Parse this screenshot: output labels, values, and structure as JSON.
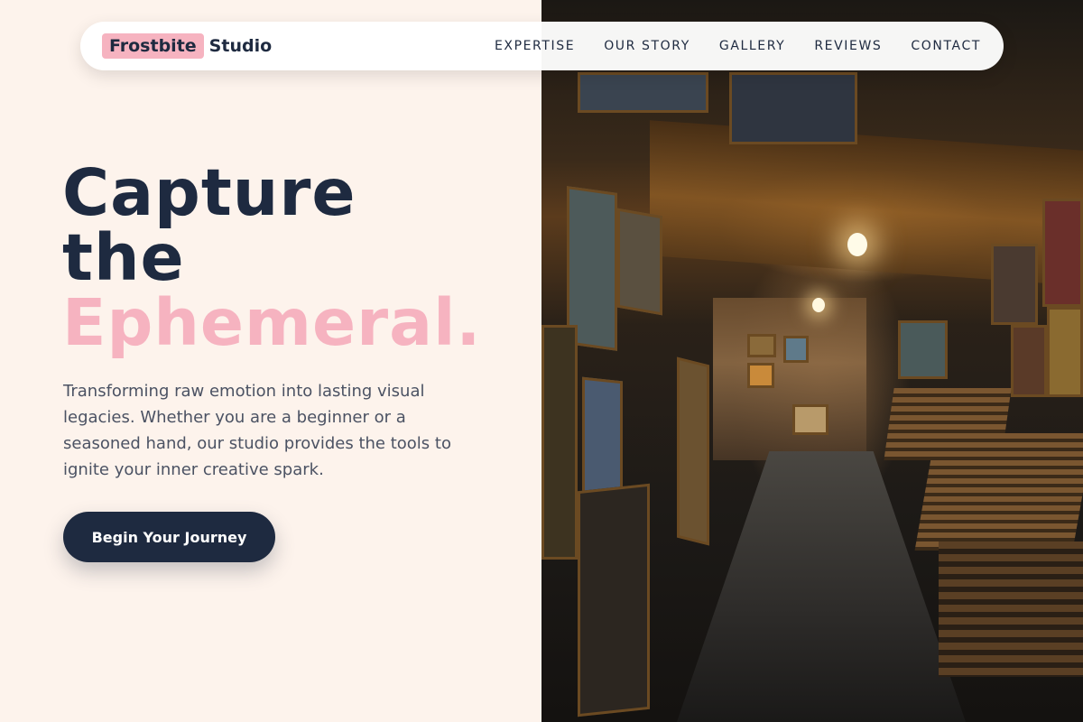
{
  "brand": {
    "mark": "Frostbite",
    "name": "Studio"
  },
  "nav": {
    "items": [
      {
        "label": "EXPERTISE"
      },
      {
        "label": "OUR STORY"
      },
      {
        "label": "GALLERY"
      },
      {
        "label": "REVIEWS"
      },
      {
        "label": "CONTACT"
      }
    ]
  },
  "hero": {
    "title_line1": "Capture",
    "title_line2": "the",
    "title_accent": "Ephemeral.",
    "description": "Transforming raw emotion into lasting visual legacies. Whether you are a beginner or a seasoned hand, our studio provides the tools to ignite your inner creative spark.",
    "cta_label": "Begin Your Journey"
  },
  "colors": {
    "background": "#fdf3ec",
    "primary": "#1e2a40",
    "accent_pink": "#f6b3c0"
  }
}
